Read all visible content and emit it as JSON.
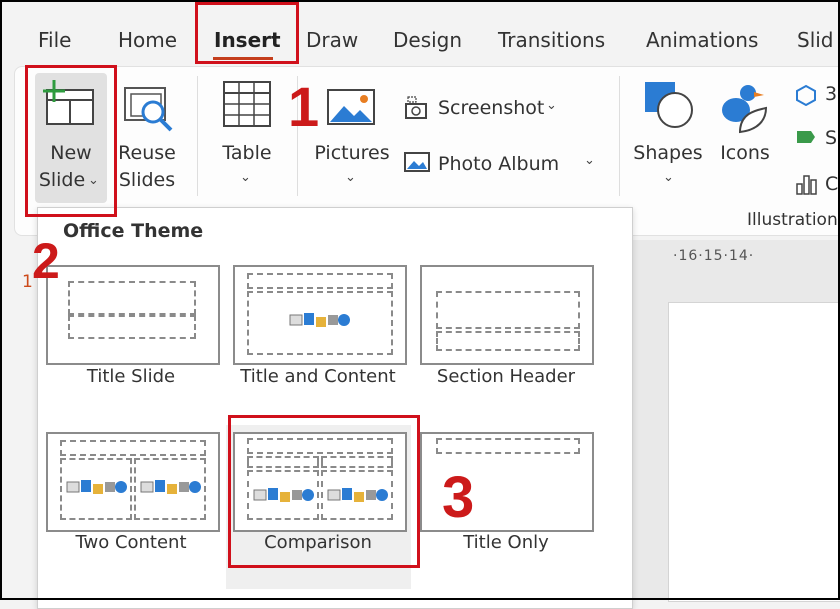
{
  "tabs": [
    "File",
    "Home",
    "Insert",
    "Draw",
    "Design",
    "Transitions",
    "Animations",
    "Slid"
  ],
  "ribbon": {
    "new_slide": [
      "New",
      "Slide"
    ],
    "reuse_slides": [
      "Reuse",
      "Slides"
    ],
    "table": "Table",
    "pictures": "Pictures",
    "screenshot": "Screenshot",
    "photo_album": "Photo Album",
    "shapes": "Shapes",
    "icons": "Icons",
    "right_partial": [
      "3",
      "S",
      "C"
    ],
    "illustrations": "Illustration"
  },
  "ruler": "·16·15·14·",
  "stray_number": "1",
  "dropdown": {
    "section_title": "Office Theme",
    "layouts": [
      "Title Slide",
      "Title and Content",
      "Section Header",
      "Two Content",
      "Comparison",
      "Title Only"
    ]
  },
  "annotations": [
    "1",
    "2",
    "3"
  ],
  "colors": {
    "accent_red": "#d0101b",
    "tab_underline": "#c43e1c",
    "icon_blue": "#2b7cd3"
  }
}
